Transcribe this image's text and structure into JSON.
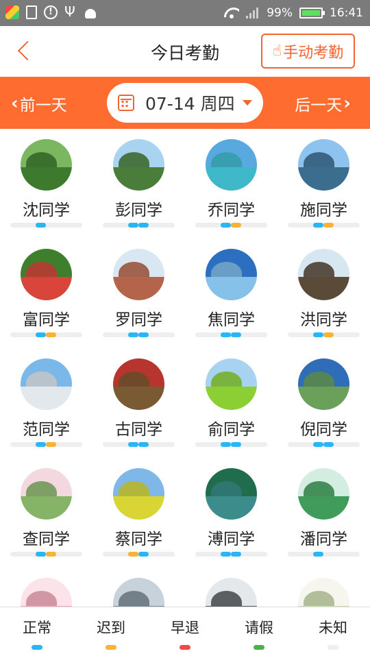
{
  "statusbar": {
    "battery": "99%",
    "time": "16:41",
    "icons": [
      "app-icon",
      "notes-icon",
      "info-icon",
      "usb-icon",
      "android-icon",
      "wifi-icon",
      "signal-icon",
      "battery-icon"
    ]
  },
  "header": {
    "back_icon": "chevron-left-icon",
    "title": "今日考勤",
    "manual_button": "手动考勤",
    "manual_icon": "hand-pointer-icon"
  },
  "datebar": {
    "prev_label": "前一天",
    "next_label": "后一天",
    "date": "07-14 周四",
    "calendar_icon": "calendar-icon",
    "dropdown_icon": "caret-down-icon"
  },
  "colors": {
    "accent": "#fe6c2f",
    "normal": "#29b6f6",
    "late": "#f9b233",
    "early": "#f24848",
    "leave": "#4caf50",
    "unknown": "#eeeeee"
  },
  "students": [
    {
      "name": "沈同学",
      "sky": "#7bb661",
      "ground": "#3d7a2e",
      "status": [
        "normal"
      ]
    },
    {
      "name": "彭同学",
      "sky": "#a8d4f2",
      "ground": "#4a7d3a",
      "status": [
        "normal",
        "normal"
      ]
    },
    {
      "name": "乔同学",
      "sky": "#58a9e0",
      "ground": "#3fb9c9",
      "status": [
        "normal",
        "late"
      ]
    },
    {
      "name": "施同学",
      "sky": "#8fc3ef",
      "ground": "#3b6d8f",
      "status": [
        "normal",
        "late"
      ]
    },
    {
      "name": "富同学",
      "sky": "#3d7f2d",
      "ground": "#d9443b",
      "status": [
        "normal",
        "late"
      ]
    },
    {
      "name": "罗同学",
      "sky": "#d8e7f2",
      "ground": "#b4644a",
      "status": [
        "normal",
        "normal"
      ]
    },
    {
      "name": "焦同学",
      "sky": "#2c6fc1",
      "ground": "#86c1ea",
      "status": [
        "normal",
        "normal"
      ]
    },
    {
      "name": "洪同学",
      "sky": "#d7e7f1",
      "ground": "#5a4a38",
      "status": [
        "normal",
        "late"
      ]
    },
    {
      "name": "范同学",
      "sky": "#79b8e8",
      "ground": "#e2e8ec",
      "status": [
        "normal",
        "late"
      ]
    },
    {
      "name": "古同学",
      "sky": "#b8342e",
      "ground": "#7a5a32",
      "status": [
        "normal",
        "normal"
      ]
    },
    {
      "name": "俞同学",
      "sky": "#a7d2f0",
      "ground": "#8ccf35",
      "status": [
        "normal",
        "normal"
      ]
    },
    {
      "name": "倪同学",
      "sky": "#2f6db8",
      "ground": "#6aa05a",
      "status": [
        "normal",
        "normal"
      ]
    },
    {
      "name": "查同学",
      "sky": "#f3d8df",
      "ground": "#86b467",
      "status": [
        "normal",
        "late"
      ]
    },
    {
      "name": "蔡同学",
      "sky": "#7fb8e8",
      "ground": "#d8d534",
      "status": [
        "late",
        "normal"
      ]
    },
    {
      "name": "溥同学",
      "sky": "#1f6d4c",
      "ground": "#3b8c8a",
      "status": [
        "normal",
        "normal"
      ]
    },
    {
      "name": "潘同学",
      "sky": "#d3ede0",
      "ground": "#3f9c5a",
      "status": [
        "normal"
      ]
    },
    {
      "name": "",
      "sky": "#fbe3e9",
      "ground": "#f2a7b9",
      "status": []
    },
    {
      "name": "",
      "sky": "#c7d2da",
      "ground": "#7d8c98",
      "status": []
    },
    {
      "name": "",
      "sky": "#e5e8ea",
      "ground": "#5a5e62",
      "status": []
    },
    {
      "name": "",
      "sky": "#f6f6ee",
      "ground": "#c9d9a8",
      "status": []
    }
  ],
  "legend": [
    {
      "label": "正常",
      "key": "normal"
    },
    {
      "label": "迟到",
      "key": "late"
    },
    {
      "label": "早退",
      "key": "early"
    },
    {
      "label": "请假",
      "key": "leave"
    },
    {
      "label": "未知",
      "key": "unknown"
    }
  ]
}
